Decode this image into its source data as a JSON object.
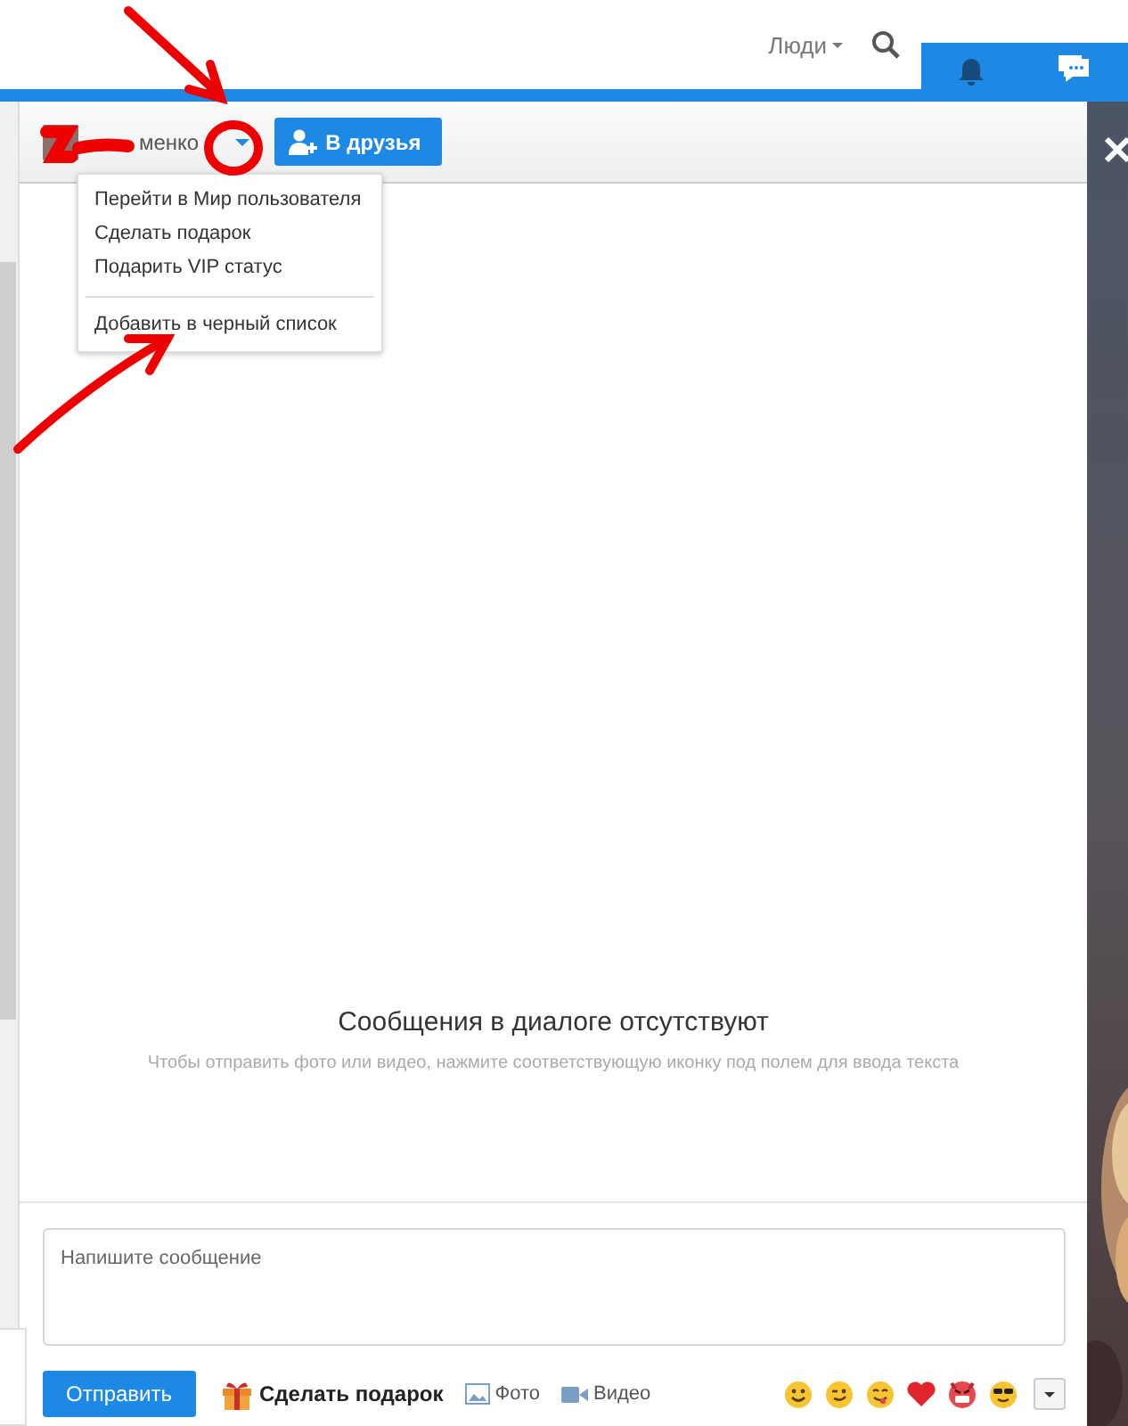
{
  "topbar": {
    "people_menu": "Люди"
  },
  "dialog": {
    "contact_name": "менко",
    "add_friend_button": "В друзья",
    "menu_groups": [
      [
        "Перейти в Мир пользователя",
        "Сделать подарок",
        "Подарить VIP статус"
      ],
      [
        "Добавить в черный список"
      ]
    ],
    "empty_title": "Сообщения в диалоге отсутствуют",
    "empty_hint": "Чтобы отправить фото или видео, нажмите соответствующую иконку под полем для ввода текста",
    "message_placeholder": "Напишите сообщение",
    "send_button": "Отправить",
    "gift_link": "Сделать подарок",
    "photo_link": "Фото",
    "video_link": "Видео"
  }
}
